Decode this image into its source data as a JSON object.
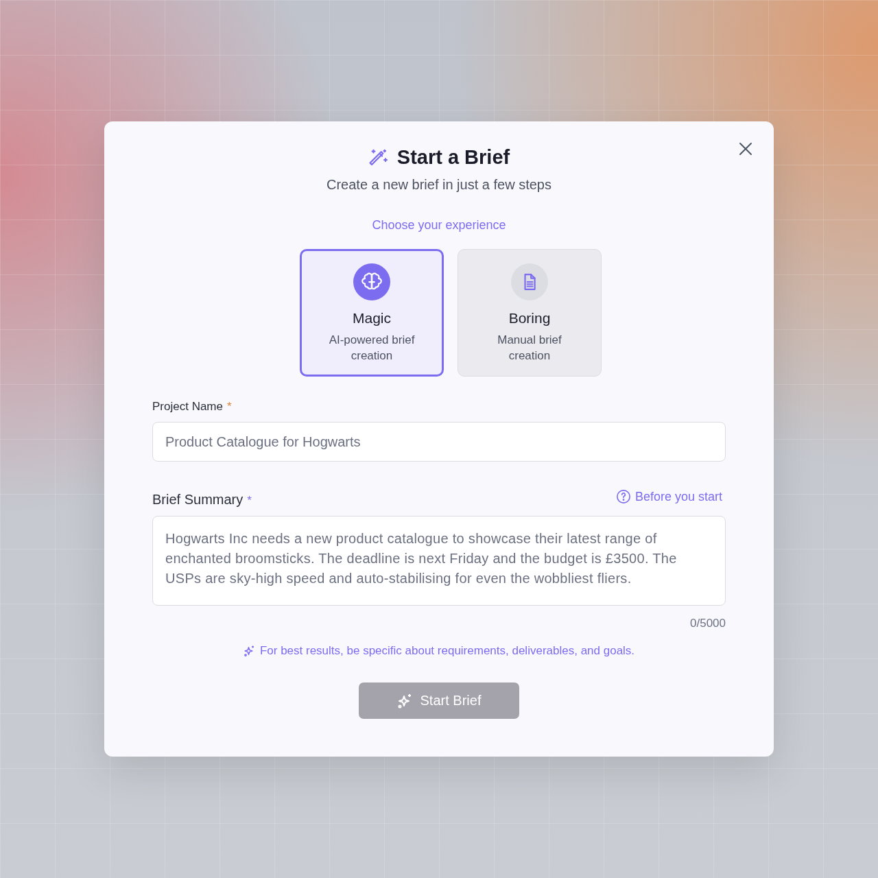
{
  "dialog": {
    "title": "Start a Brief",
    "subtitle": "Create a new brief in just a few steps",
    "section_label": "Choose your experience",
    "options": [
      {
        "kind": "magic",
        "title": "Magic",
        "description": "AI-powered brief creation",
        "selected": true
      },
      {
        "kind": "manual",
        "title": "Boring",
        "description": "Manual brief creation",
        "selected": false
      }
    ],
    "project_name": {
      "label": "Project Name",
      "required_mark": "*",
      "placeholder": "Product Catalogue for Hogwarts"
    },
    "brief_summary": {
      "label": "Brief Summary",
      "required_mark": "*",
      "help_link": "Before you start",
      "placeholder": "Hogwarts Inc needs a new product catalogue to showcase their latest range of enchanted broomsticks. The deadline is next Friday and the budget is £3500. The USPs are sky-high speed and auto-stabilising for even the wobbliest fliers.",
      "counter": "0/5000"
    },
    "tip": "For best results, be specific about requirements, deliverables, and goals.",
    "submit": {
      "label": "Start Brief",
      "disabled": true
    }
  }
}
